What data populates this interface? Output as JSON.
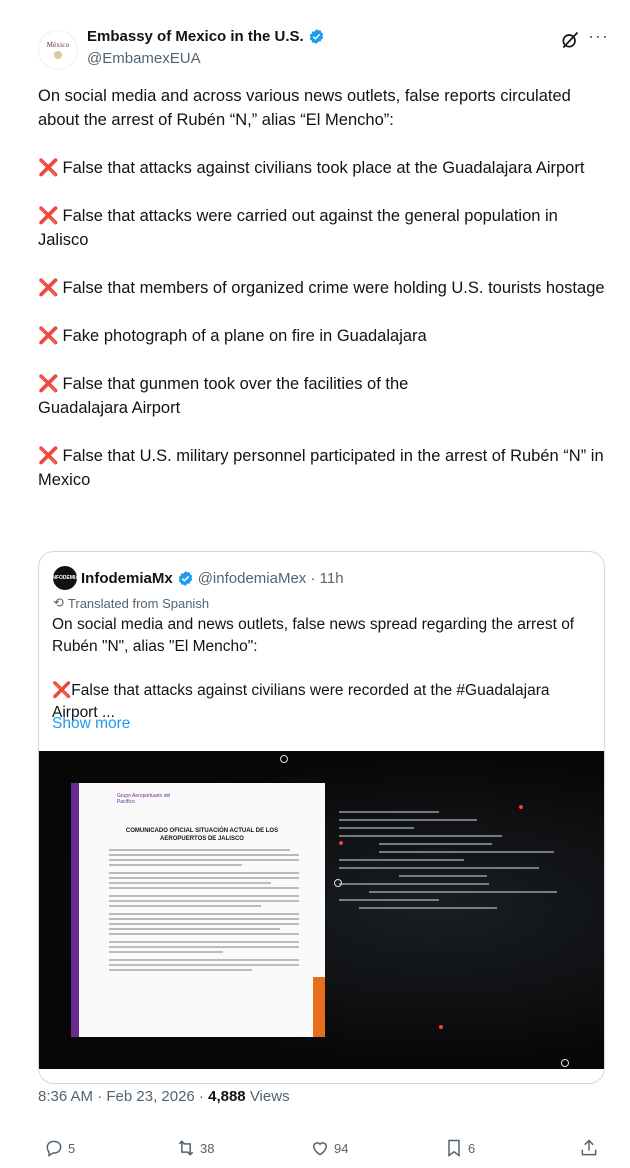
{
  "author": {
    "name": "Embassy of Mexico in the U.S.",
    "handle": "@EmbamexEUA",
    "avatar_text": "México"
  },
  "tweet": {
    "intro": "On social media and across various news outlets, false reports circulated about the arrest of Rubén “N,” alias “El Mencho”:",
    "mark": "❌",
    "items": [
      "False that attacks against civilians took place at the Guadalajara Airport",
      "False that attacks were carried out against the general population in Jalisco",
      "False that members of organized crime were holding U.S. tourists hostage",
      "Fake photograph of a plane on fire in Guadalajara",
      "False that gunmen took over the facilities of the Guadalajara Airport",
      "False that U.S. military personnel participated in the arrest of Rubén “N” in Mexico"
    ]
  },
  "quote": {
    "avatar_text": "INFODEMIA",
    "name": "InfodemiaMx",
    "handle": "@infodemiaMex · 11h",
    "translated": "Translated from Spanish",
    "line1": "On social media and news outlets, false news spread regarding the arrest of Rubén \"N\", alias \"El Mencho\":",
    "line2": "❌False that attacks against civilians were recorded at the #Guadalajara Airport  ...",
    "show_more": "Show more",
    "doc_logo": "Grupo Aeroportuario del Pacífico",
    "doc_title": "COMUNICADO OFICIAL SITUACIÓN ACTUAL DE LOS AEROPUERTOS DE JALISCO"
  },
  "meta": {
    "time": "8:36 AM · Feb 23, 2026 · ",
    "views_count": "4,888",
    "views_label": " Views"
  },
  "actions": {
    "replies": "5",
    "reposts": "38",
    "likes": "94",
    "bookmarks": "6"
  },
  "colors": {
    "verified": "#1d9bf0",
    "link": "#1d9bf0",
    "xmark": "#e0245e"
  }
}
